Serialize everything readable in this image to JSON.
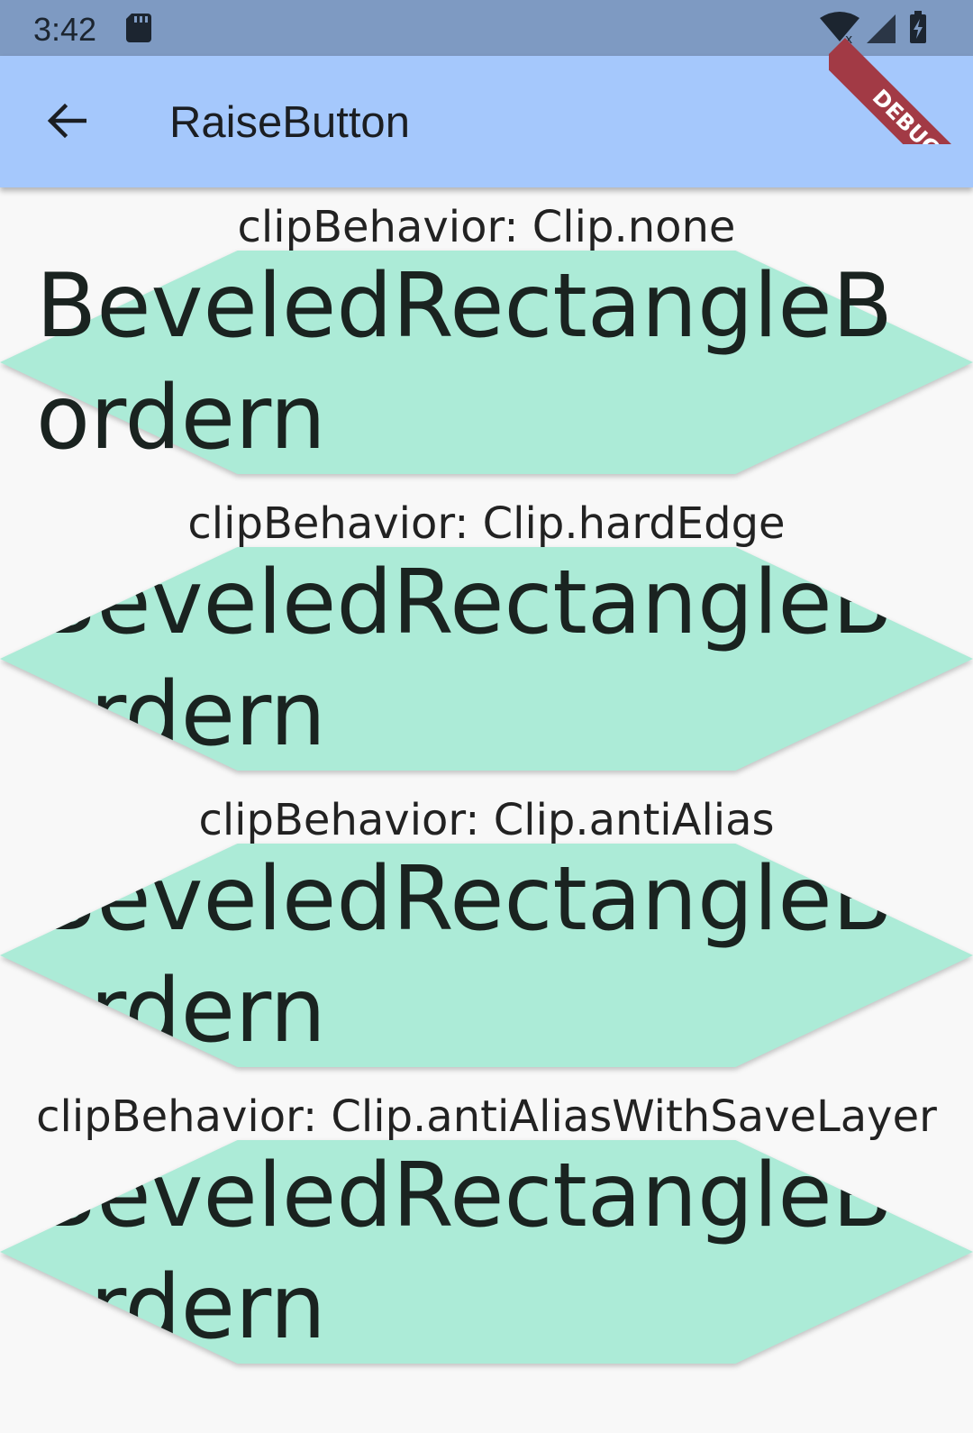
{
  "status_bar": {
    "time": "3:42",
    "icons": [
      "sd-card-icon",
      "wifi-icon",
      "signal-icon",
      "battery-charging-icon"
    ]
  },
  "app_bar": {
    "back_icon": "arrow-back-icon",
    "title": "RaiseButton"
  },
  "debug_banner": "DEBUG",
  "colors": {
    "status_bar": "#7e9ac2",
    "app_bar": "#a5c8fc",
    "button_fill": "#acebd7",
    "background": "#f8f8f8",
    "debug_ribbon": "#a23a45"
  },
  "sections": [
    {
      "label": "clipBehavior: Clip.none",
      "button_text": "BeveledRectangleBordern",
      "clip": "none"
    },
    {
      "label": "clipBehavior: Clip.hardEdge",
      "button_text": "BeveledRectangleBordern",
      "clip": "hardEdge"
    },
    {
      "label": "clipBehavior: Clip.antiAlias",
      "button_text": "BeveledRectangleBordern",
      "clip": "antiAlias"
    },
    {
      "label": "clipBehavior: Clip.antiAliasWithSaveLayer",
      "button_text": "BeveledRectangleBordern",
      "clip": "antiAliasWithSaveLayer"
    }
  ]
}
